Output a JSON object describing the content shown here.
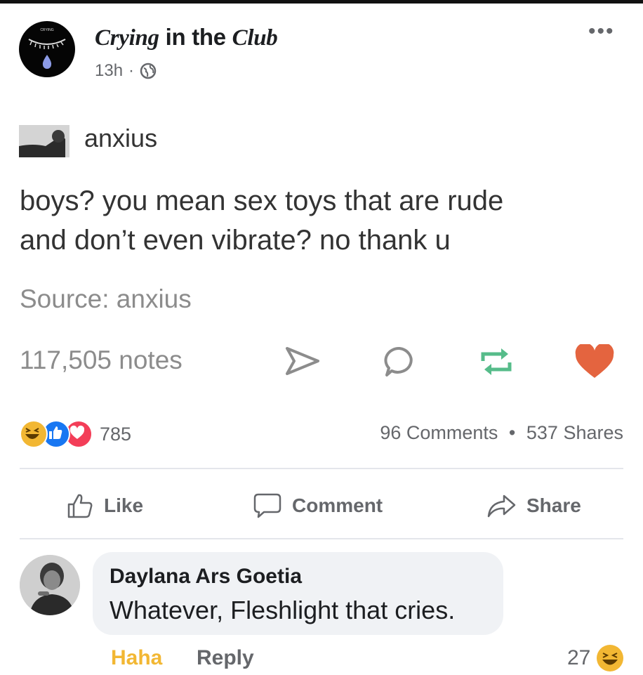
{
  "post": {
    "page_name_part1": "Crying",
    "page_name_part2": " in the ",
    "page_name_part3": "Club",
    "time": "13h",
    "separator": "·",
    "more": "•••"
  },
  "shared": {
    "username": "anxius",
    "text_line1": "boys? you mean sex toys that are rude",
    "text_line2": "and don’t even vibrate? no thank u",
    "source": "Source: anxius",
    "notes": "117,505 notes"
  },
  "reactions": {
    "count": "785",
    "comments": "96 Comments",
    "dot": "•",
    "shares": "537 Shares"
  },
  "actions": {
    "like": "Like",
    "comment": "Comment",
    "share": "Share"
  },
  "comment": {
    "author": "Daylana Ars Goetia",
    "text": "Whatever, Fleshlight that cries.",
    "reaction_link": "Haha",
    "reply": "Reply",
    "reaction_count": "27"
  },
  "colors": {
    "facebook_gray": "#65676b",
    "tumblr_green": "#56bc8a",
    "heart_red": "#e4643f",
    "haha_yellow": "#f2b733",
    "love_red": "#f33e58",
    "like_blue": "#1877f2"
  }
}
